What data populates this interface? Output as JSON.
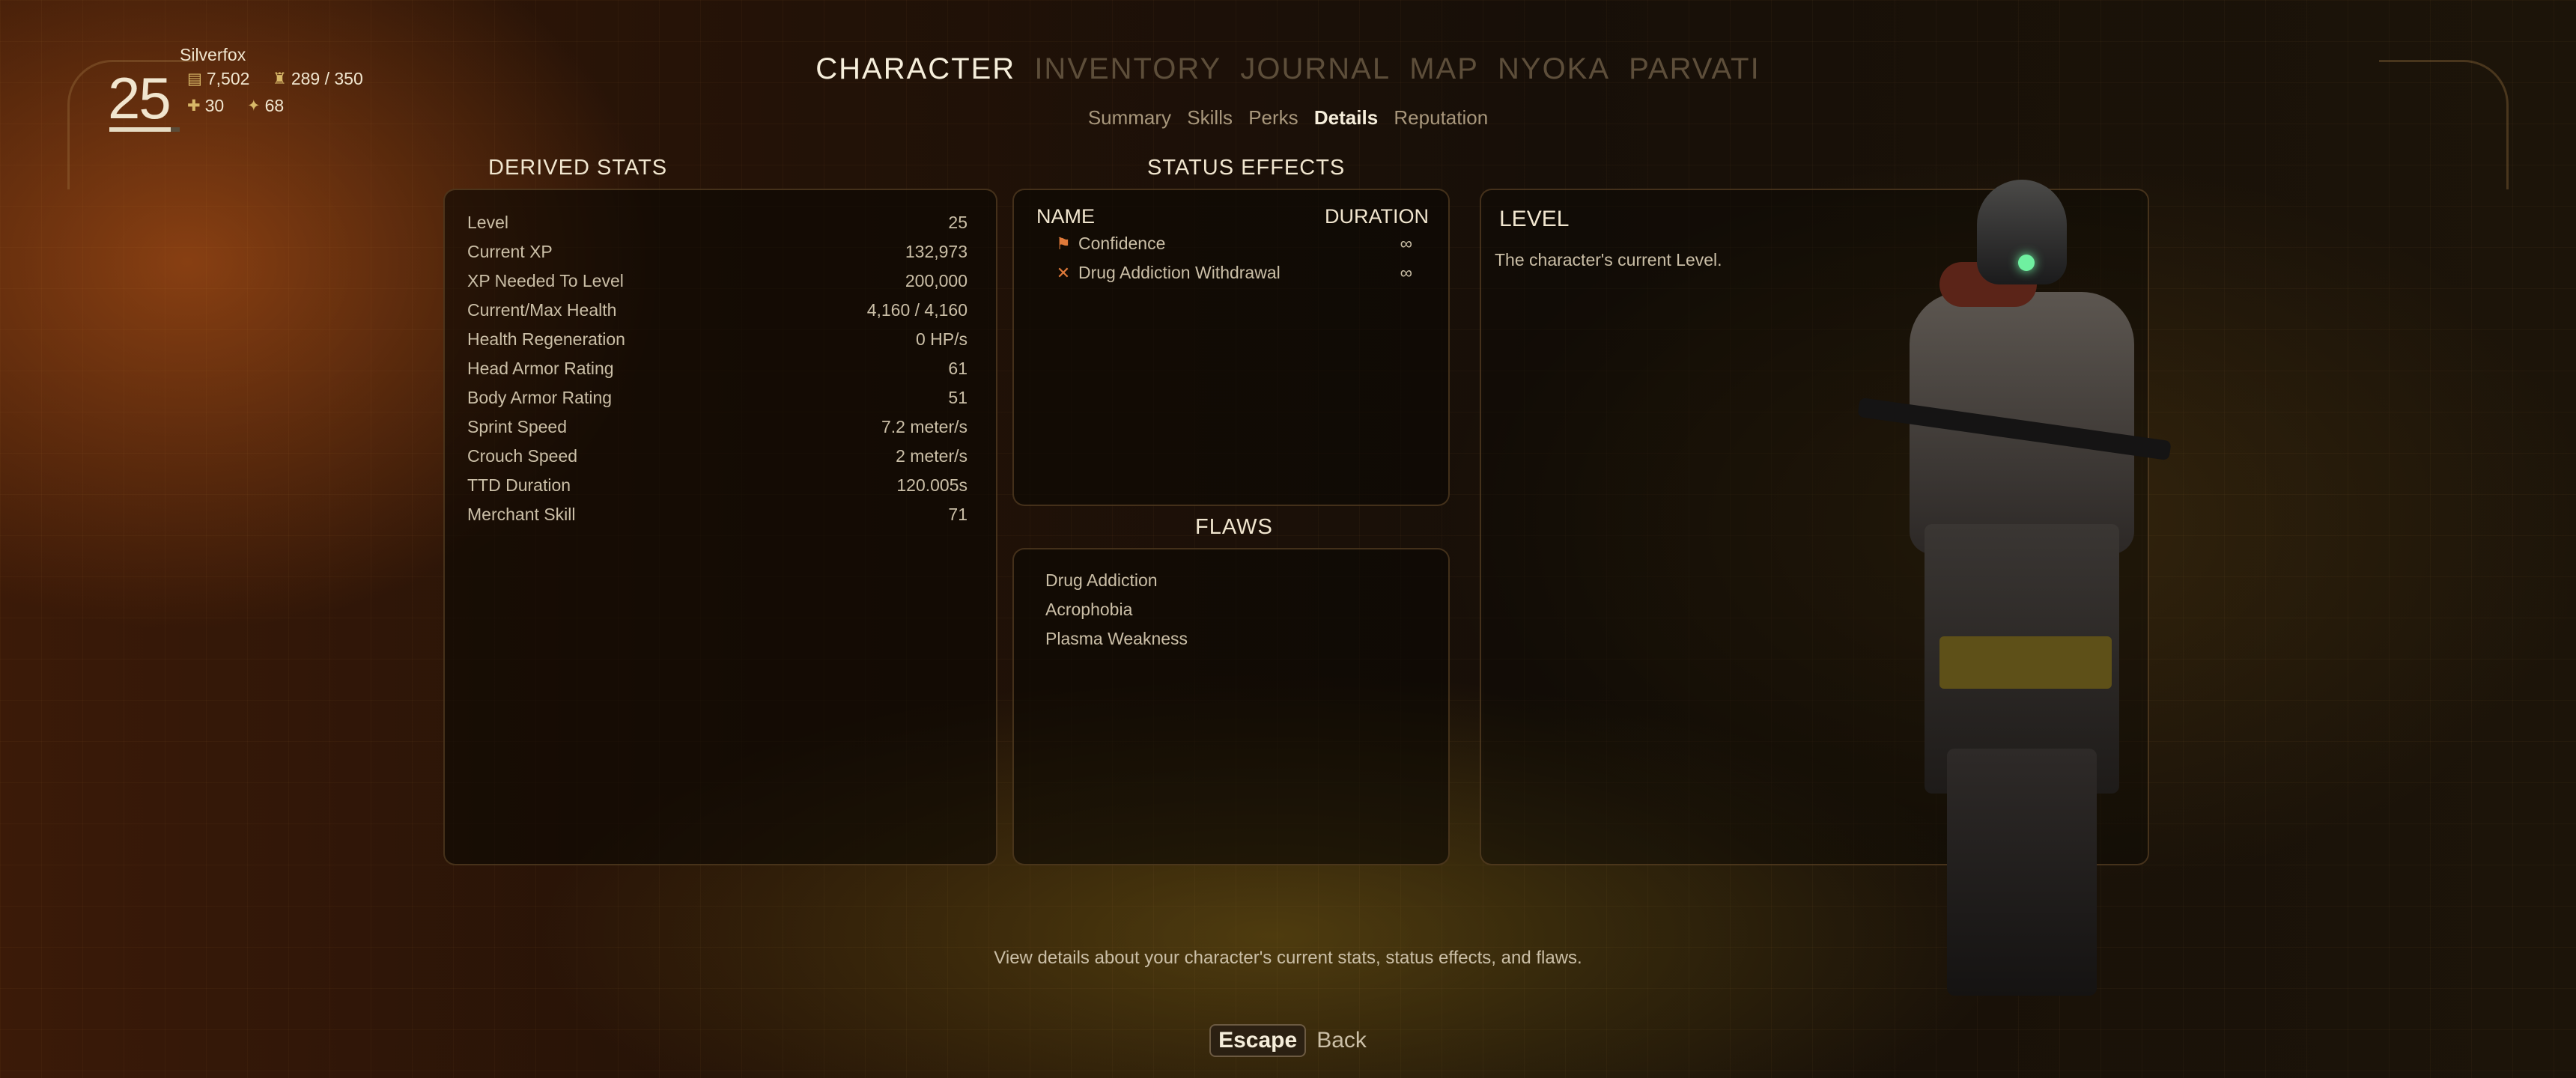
{
  "player": {
    "level": "25",
    "name": "Silverfox",
    "bits": "7,502",
    "carry": "289 / 350",
    "inhaler": "30",
    "medical": "68",
    "level_progress": 0.87
  },
  "nav": {
    "tabs": [
      {
        "label": "CHARACTER",
        "active": true
      },
      {
        "label": "INVENTORY",
        "active": false
      },
      {
        "label": "JOURNAL",
        "active": false
      },
      {
        "label": "MAP",
        "active": false
      },
      {
        "label": "NYOKA",
        "active": false
      },
      {
        "label": "PARVATI",
        "active": false
      }
    ],
    "subtabs": [
      {
        "label": "Summary",
        "active": false
      },
      {
        "label": "Skills",
        "active": false
      },
      {
        "label": "Perks",
        "active": false
      },
      {
        "label": "Details",
        "active": true
      },
      {
        "label": "Reputation",
        "active": false
      }
    ]
  },
  "derived_stats": {
    "title": "DERIVED STATS",
    "rows": [
      {
        "label": "Level",
        "value": "25"
      },
      {
        "label": "Current XP",
        "value": "132,973"
      },
      {
        "label": "XP Needed To Level",
        "value": "200,000"
      },
      {
        "label": "Current/Max Health",
        "value": "4,160 / 4,160"
      },
      {
        "label": "Health Regeneration",
        "value": "0 HP/s"
      },
      {
        "label": "Head Armor Rating",
        "value": "61"
      },
      {
        "label": "Body Armor Rating",
        "value": "51"
      },
      {
        "label": "Sprint Speed",
        "value": "7.2 meter/s"
      },
      {
        "label": "Crouch Speed",
        "value": "2 meter/s"
      },
      {
        "label": "TTD Duration",
        "value": "120.005s"
      },
      {
        "label": "Merchant Skill",
        "value": "71"
      }
    ]
  },
  "status_effects": {
    "title": "STATUS EFFECTS",
    "col_name": "NAME",
    "col_duration": "DURATION",
    "items": [
      {
        "icon": "flag-icon",
        "name": "Confidence",
        "duration": "∞"
      },
      {
        "icon": "crossed-syringe-icon",
        "name": "Drug Addiction Withdrawal",
        "duration": "∞"
      }
    ]
  },
  "flaws": {
    "title": "FLAWS",
    "items": [
      "Drug Addiction",
      "Acrophobia",
      "Plasma Weakness"
    ]
  },
  "info": {
    "title": "LEVEL",
    "description": "The character's current Level."
  },
  "hint": "View details about your character's current stats, status effects, and flaws.",
  "footer": {
    "key": "Escape",
    "action": "Back"
  },
  "colors": {
    "accent": "#f1e6cf",
    "inactive_tab": "#5d4e3a",
    "effect_icon": "#e07a3a"
  }
}
